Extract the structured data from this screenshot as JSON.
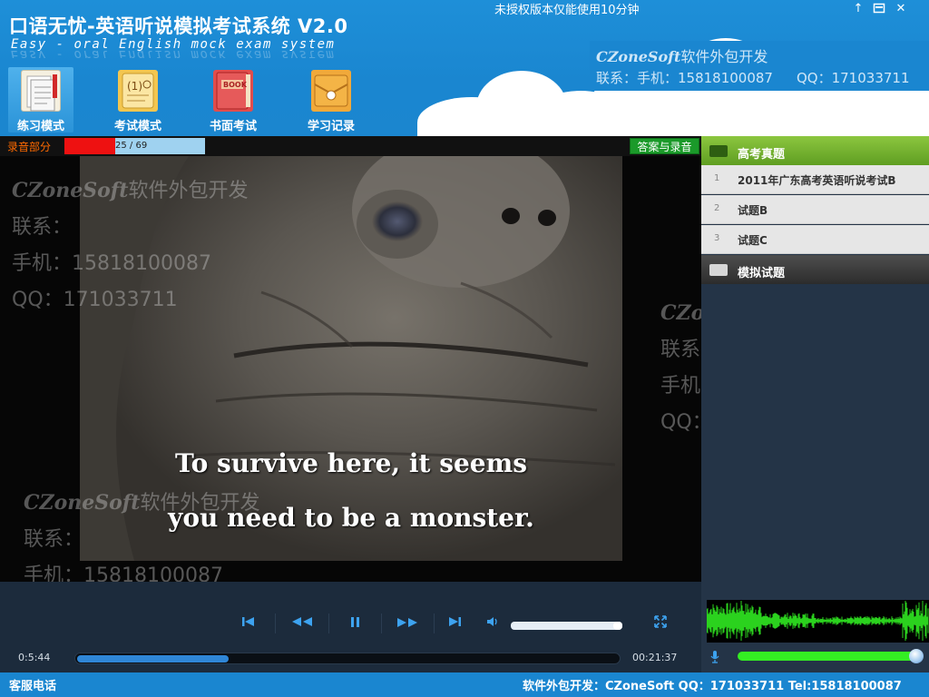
{
  "header": {
    "title": "口语无忧-英语听说模拟考试系统 V2.0",
    "subtitle": "Easy - oral English mock exam system",
    "license_notice": "未授权版本仅能使用10分钟",
    "brand_bold": "CZoneSoft",
    "brand_text": "软件外包开发",
    "contact_phone": "联系：手机：15818100087",
    "contact_qq": "QQ：171033711"
  },
  "window_controls": {
    "pin": "↑",
    "restore": "▭",
    "close": "✕"
  },
  "nav": {
    "items": [
      {
        "label": "练习模式",
        "icon": "notepad-icon",
        "active": true
      },
      {
        "label": "考试模式",
        "icon": "exam-paper-icon",
        "active": false
      },
      {
        "label": "书面考试",
        "icon": "book-icon",
        "active": false
      },
      {
        "label": "学习记录",
        "icon": "envelope-icon",
        "active": false
      }
    ],
    "book_icon_text": "BOOK"
  },
  "recording": {
    "label": "录音部分",
    "current": 25,
    "total": 69,
    "count_text": "25  /  69",
    "progress_fraction": 0.36,
    "answer_button": "答案与录音"
  },
  "video": {
    "subtitle_line1": "To survive here, it seems",
    "subtitle_line2": "you need to be a monster."
  },
  "watermark": {
    "brand_bold": "CZoneSoft",
    "brand_text": "软件外包开发",
    "contact": "联系：",
    "phone": "手机：15818100087",
    "qq": "QQ：171033711"
  },
  "player": {
    "elapsed": "0:5:44",
    "duration": "00:21:37",
    "progress_fraction": 0.28,
    "volume_fraction": 0.92,
    "icons": {
      "prev": "⏮",
      "rewind": "⏪",
      "pause": "⏸",
      "forward": "⏩",
      "next": "⏭",
      "volume": "🔈",
      "fullscreen": "⤢",
      "mic": "🎙"
    }
  },
  "right_panel": {
    "category1": "高考真题",
    "items": [
      {
        "num": "1",
        "label": "2011年广东高考英语听说考试B"
      },
      {
        "num": "2",
        "label": "试题B"
      },
      {
        "num": "3",
        "label": "试题C"
      }
    ],
    "category2": "模拟试题",
    "mic_level_fraction": 0.96
  },
  "status": {
    "left": "客服电话",
    "right": "软件外包开发：CZoneSoft QQ：171033711 Tel:15818100087"
  },
  "colors": {
    "header_blue": "#1a86d0",
    "record_red": "#ee1111",
    "answer_green": "#1b9a2a",
    "accent_blue": "#3da3f0",
    "level_green": "#34ee23"
  }
}
